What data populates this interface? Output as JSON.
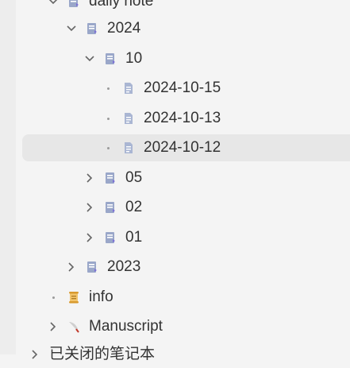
{
  "tree": {
    "daily_note": {
      "label": "daily note",
      "icon": "notebook-icon"
    },
    "y2024": {
      "label": "2024",
      "icon": "notebook-icon"
    },
    "m10": {
      "label": "10",
      "icon": "notebook-icon"
    },
    "d15": {
      "label": "2024-10-15",
      "icon": "document-icon"
    },
    "d13": {
      "label": "2024-10-13",
      "icon": "document-icon"
    },
    "d12": {
      "label": "2024-10-12",
      "icon": "document-icon",
      "selected": true
    },
    "m05": {
      "label": "05",
      "icon": "notebook-icon"
    },
    "m02": {
      "label": "02",
      "icon": "notebook-icon"
    },
    "m01": {
      "label": "01",
      "icon": "notebook-icon"
    },
    "y2023": {
      "label": "2023",
      "icon": "notebook-icon"
    },
    "info": {
      "label": "info",
      "icon": "scroll-icon"
    },
    "manuscript": {
      "label": "Manuscript",
      "icon": "quill-pen-icon"
    },
    "closed": {
      "label": "已关闭的笔记本"
    }
  },
  "more_menu": {
    "label": "⋮"
  },
  "colors": {
    "accent": "#7b6fd6",
    "selected_bg": "#e7e7e7",
    "panel_bg": "#f4f4f4"
  }
}
